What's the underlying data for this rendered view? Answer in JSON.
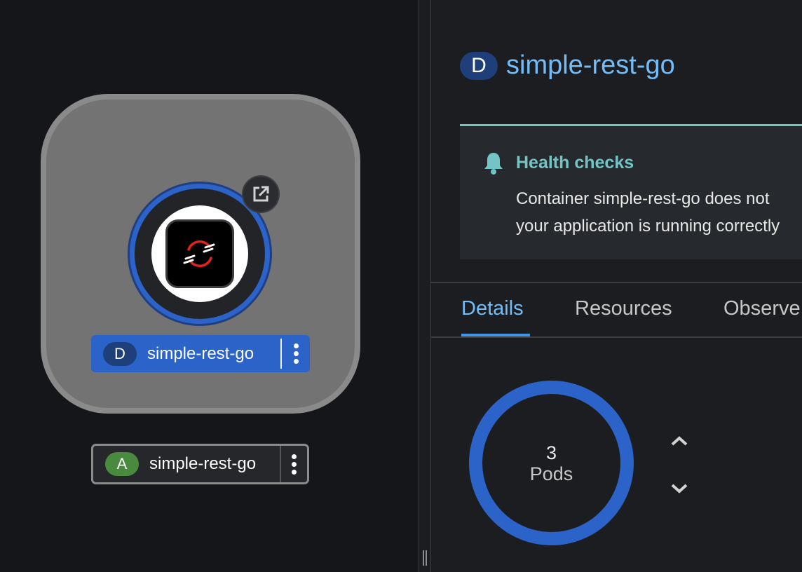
{
  "topology": {
    "deployment_node": {
      "badge": "D",
      "name": "simple-rest-go",
      "icon": "openshift-logo-icon",
      "external_link_icon": "external-link-icon"
    },
    "application_group": {
      "badge": "A",
      "name": "simple-rest-go"
    }
  },
  "panel": {
    "badge": "D",
    "title": "simple-rest-go",
    "alert": {
      "title": "Health checks",
      "line1": "Container simple-rest-go does not",
      "line2": "your application is running correctly"
    },
    "tabs": [
      "Details",
      "Resources",
      "Observe"
    ],
    "active_tab": "Details",
    "pods": {
      "count": "3",
      "unit": "Pods"
    }
  },
  "colors": {
    "accent": "#73bcf7",
    "deployment_blue": "#2b63c9",
    "alert_teal": "#73c5c5",
    "app_badge_green": "#4a8a3e"
  }
}
